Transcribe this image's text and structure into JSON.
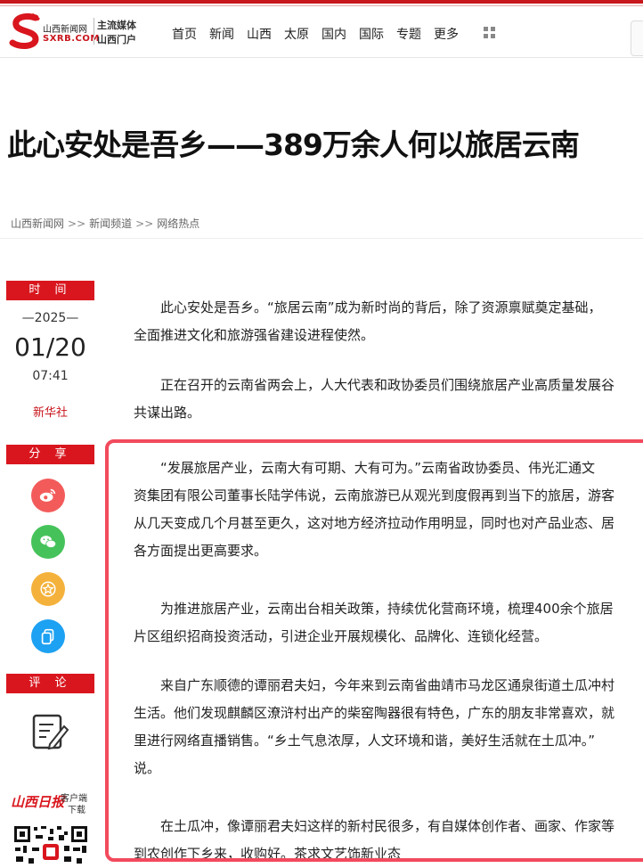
{
  "header": {
    "logo_name": "山西新闻网",
    "logo_domain": "SXRB.COM",
    "slogan_line1": "主流媒体",
    "slogan_line2": "山西门户",
    "nav": [
      "首页",
      "新闻",
      "山西",
      "太原",
      "国内",
      "国际",
      "专题",
      "更多"
    ]
  },
  "article": {
    "title": "此心安处是吾乡——389万余人何以旅居云南",
    "breadcrumb": [
      "山西新闻网",
      "新闻频道",
      "网络热点"
    ],
    "breadcrumb_separator": ">>",
    "paragraphs": [
      [
        "此心安处是吾乡。“旅居云南”成为新时尚的背后，除了资源禀赋奠定基础，",
        "全面推进文化和旅游强省建设进程使然。"
      ],
      [
        "正在召开的云南省两会上，人大代表和政协委员们围绕旅居产业高质量发展谷",
        "共谋出路。"
      ],
      [
        "“发展旅居产业，云南大有可期、大有可为。”云南省政协委员、伟光汇通文",
        "资集团有限公司董事长陆学伟说，云南旅游已从观光到度假再到当下的旅居，游客",
        "从几天变成几个月甚至更久，这对地方经济拉动作用明显，同时也对产品业态、居",
        "各方面提出更高要求。"
      ],
      [
        "为推进旅居产业，云南出台相关政策，持续优化营商环境，梳理400余个旅居",
        "片区组织招商投资活动，引进企业开展规模化、品牌化、连锁化经营。"
      ],
      [
        "来自广东顺德的谭丽君夫妇，今年来到云南省曲靖市马龙区通泉街道土瓜冲村",
        "生活。他们发现麒麟区潦浒村出产的柴窑陶器很有特色，广东的朋友非常喜欢，就",
        "里进行网络直播销售。“乡土气息浓厚，人文环境和谐，美好生活就在土瓜冲。”",
        "说。"
      ],
      [
        "在土瓜冲，像谭丽君夫妇这样的新村民很多，有自媒体创作者、画家、作家等",
        "到农创作下乡来，收购好。茶求文艺饰新业态"
      ]
    ]
  },
  "sidebar": {
    "time_label": "时 间",
    "year": "—2025—",
    "date": "01/20",
    "time": "07:41",
    "source": "新华社",
    "share_label": "分 享",
    "share_buttons": [
      {
        "icon": "weibo-icon",
        "color": "#f35b5b"
      },
      {
        "icon": "wechat-icon",
        "color": "#46c25a"
      },
      {
        "icon": "favorite-star-icon",
        "color": "#f4b23c"
      },
      {
        "icon": "copy-link-icon",
        "color": "#1da1f2"
      }
    ],
    "comment_label": "评 论",
    "app_brand": "山西日报",
    "app_caption1": "客户端",
    "app_caption2": "下载"
  },
  "colors": {
    "brand_red": "#d9161e",
    "highlight_border": "#f24a5d"
  }
}
